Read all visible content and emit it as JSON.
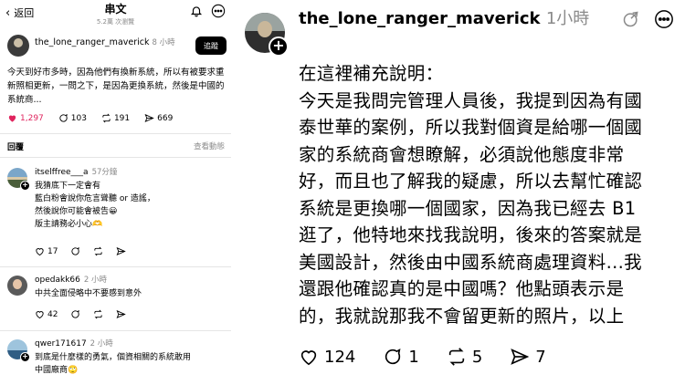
{
  "left": {
    "topbar": {
      "back_label": "返回",
      "title": "串文",
      "subtitle": "5.2萬 次瀏覽"
    },
    "post": {
      "username": "the_lone_ranger_maverick",
      "time": "8 小時",
      "follow_label": "追蹤",
      "text": "今天到好市多時，因為他們有換新系統，所以有被要求重新照相更新，一問之下，是因為更換系統，然後是中國的系統商...",
      "likes": "1,297",
      "replies": "103",
      "reposts": "191",
      "shares": "669"
    },
    "reply_header": {
      "label": "回覆",
      "more": "查看動態"
    },
    "comments": [
      {
        "username": "itselffree___a",
        "time": "57分鐘",
        "lines": [
          "我猜底下一定會有",
          "藍白粉會說你危言聳聽 or 造謠，",
          "然後說你可能會被告😀",
          "版主請務必小心🫶"
        ],
        "likes": "17",
        "replies": "",
        "reposts": "",
        "shares": ""
      },
      {
        "username": "opedakk66",
        "time": "2 小時",
        "lines": [
          "中共全面侵略中不要感到意外"
        ],
        "likes": "42",
        "replies": "",
        "reposts": "",
        "shares": ""
      },
      {
        "username": "qwer171617",
        "time": "2 小時",
        "lines": [
          "到底是什麼樣的勇氣，個資相關的系統敢用",
          "中國廠商🙄"
        ],
        "likes": "",
        "replies": "",
        "reposts": "",
        "shares": ""
      }
    ]
  },
  "right": {
    "username": "the_lone_ranger_maverick",
    "time": "1小時",
    "lines": [
      "在這裡補充說明：",
      "今天是我問完管理人員後，我提到因為有國",
      "泰世華的案例，所以我對個資是給哪一個國",
      "家的系統商會想瞭解，必須說他態度非常",
      "好，而且也了解我的疑慮，所以去幫忙確認",
      "系統是更換哪一個國家，因為我已經去 B1",
      "逛了，他特地來找我說明，後來的答案就是",
      "美國設計，然後由中國系統商處理資料...我",
      "還跟他確認真的是中國嗎？他點頭表示是",
      "的，我就說那我不會留更新的照片，以上"
    ],
    "likes": "124",
    "replies": "1",
    "reposts": "5",
    "shares": "7"
  },
  "colors": {
    "liked": "#e0245e",
    "muted": "#8a8a8a"
  }
}
